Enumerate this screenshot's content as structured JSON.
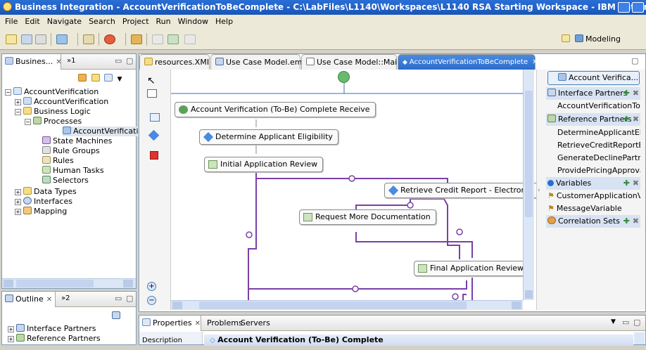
{
  "window": {
    "title": "Business Integration - AccountVerificationToBeComplete - C:\\LabFiles\\L1140\\Workspaces\\L1140 RSA Starting Workspace - IBM Rational Software De..."
  },
  "menu": [
    "File",
    "Edit",
    "Navigate",
    "Search",
    "Project",
    "Run",
    "Window",
    "Help"
  ],
  "perspective": {
    "label": "Modeling"
  },
  "left_panel": {
    "tab_label": "Busines...",
    "tab_extra": "»1",
    "tree": [
      {
        "label": "AccountVerification",
        "level": 0,
        "expander": "−"
      },
      {
        "label": "AccountVerification",
        "level": 1,
        "expander": "+"
      },
      {
        "label": "Business Logic",
        "level": 1,
        "expander": "−"
      },
      {
        "label": "Processes",
        "level": 2,
        "expander": "−"
      },
      {
        "label": "AccountVerification",
        "level": 3,
        "expander": "",
        "selected": true
      },
      {
        "label": "State Machines",
        "level": 2,
        "expander": ""
      },
      {
        "label": "Rule Groups",
        "level": 2,
        "expander": ""
      },
      {
        "label": "Rules",
        "level": 2,
        "expander": ""
      },
      {
        "label": "Human Tasks",
        "level": 2,
        "expander": ""
      },
      {
        "label": "Selectors",
        "level": 2,
        "expander": ""
      },
      {
        "label": "Data Types",
        "level": 1,
        "expander": "+"
      },
      {
        "label": "Interfaces",
        "level": 1,
        "expander": "+"
      },
      {
        "label": "Mapping",
        "level": 1,
        "expander": "+"
      }
    ]
  },
  "outline_panel": {
    "tab_label": "Outline",
    "tab_extra": "»2",
    "items": [
      "Interface Partners",
      "Reference Partners"
    ]
  },
  "editor_tabs": [
    {
      "label": "resources.XMI",
      "active": false
    },
    {
      "label": "Use Case Model.emx",
      "active": false
    },
    {
      "label": "Use Case Model::Main",
      "active": false
    },
    {
      "label": "AccountVerificationToBeComplete",
      "active": true
    }
  ],
  "diagram": {
    "nodes": [
      {
        "id": "receive",
        "label": "Account Verification (To-Be) Complete Receive"
      },
      {
        "id": "eligibility",
        "label": "Determine Applicant Eligibility"
      },
      {
        "id": "initial",
        "label": "Initial Application Review"
      },
      {
        "id": "credit",
        "label": "Retrieve Credit Report - Electronic"
      },
      {
        "id": "docs",
        "label": "Request More Documentation"
      },
      {
        "id": "final",
        "label": "Final Application Review"
      }
    ]
  },
  "right_panel": {
    "header": "Account Verifica...",
    "sections": [
      {
        "title": "Interface Partners",
        "items": [
          "AccountVerificationToBe..."
        ]
      },
      {
        "title": "Reference Partners",
        "items": [
          "DetermineApplicantEligi...",
          "RetrieveCreditReportEl...",
          "GenerateDeclinePartner",
          "ProvidePricingApprovalP..."
        ]
      },
      {
        "title": "Variables",
        "items": [
          "CustomerApplicationVari...",
          "MessageVariable"
        ]
      },
      {
        "title": "Correlation Sets",
        "items": []
      }
    ]
  },
  "bottom_panel": {
    "tabs": [
      "Properties",
      "Problems",
      "Servers"
    ],
    "side_label": "Description",
    "title": "Account Verification (To-Be) Complete"
  },
  "colors": {
    "flow": "#7b3fa8",
    "start": "#69b96f",
    "accent": "#2c6ccc"
  }
}
